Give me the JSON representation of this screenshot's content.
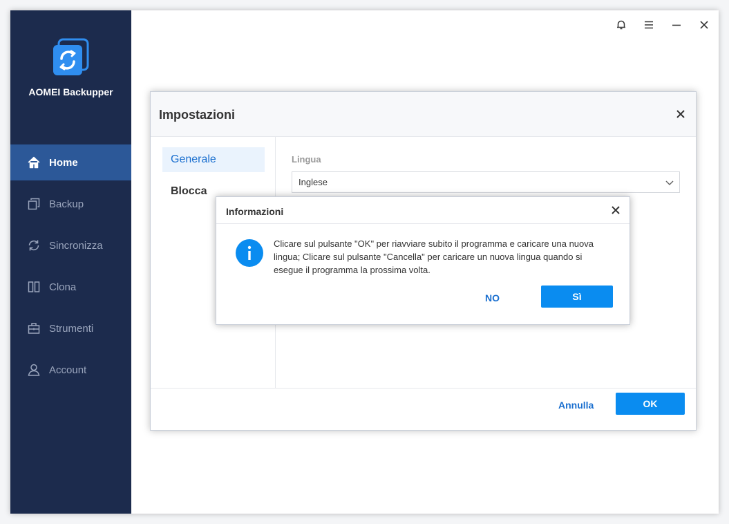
{
  "app": {
    "name": "AOMEI Backupper",
    "accent": "#0a8cf0",
    "sidebar_bg": "#1c2b4d",
    "active_bg": "#2c5898"
  },
  "sidebar": {
    "items": [
      {
        "label": "Home",
        "icon": "home-icon",
        "active": true
      },
      {
        "label": "Backup",
        "icon": "backup-icon",
        "active": false
      },
      {
        "label": "Sincronizza",
        "icon": "sync-icon",
        "active": false
      },
      {
        "label": "Clona",
        "icon": "clone-icon",
        "active": false
      },
      {
        "label": "Strumenti",
        "icon": "tools-icon",
        "active": false
      },
      {
        "label": "Account",
        "icon": "account-icon",
        "active": false
      }
    ]
  },
  "window_controls": [
    "bell-icon",
    "menu-icon",
    "minimize-icon",
    "close-icon"
  ],
  "settings": {
    "title": "Impostazioni",
    "tabs": [
      {
        "label": "Generale",
        "active": true
      },
      {
        "label": "Blocca",
        "active": false
      }
    ],
    "language_label": "Lingua",
    "language_value": "Inglese",
    "cancel_label": "Annulla",
    "ok_label": "OK"
  },
  "info_dialog": {
    "title": "Informazioni",
    "message_lines": [
      "Clicare sul pulsante \"OK\" per riavviare subito il programma e caricare una nuova",
      "lingua; Clicare sul pulsante \"Cancella\" per caricare un nuova lingua quando si",
      "esegue il programma la prossima volta."
    ],
    "no_label": "NO",
    "yes_label": "Sì"
  }
}
